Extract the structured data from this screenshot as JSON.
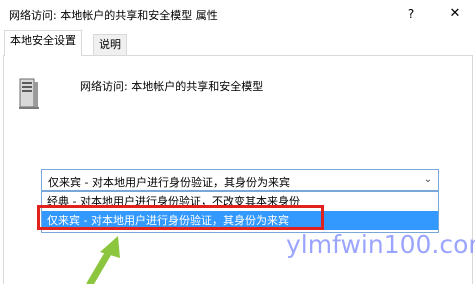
{
  "window": {
    "title": "网络访问: 本地帐户的共享和安全模型 属性",
    "help_label": "?",
    "close_label": "✕"
  },
  "tabs": [
    {
      "label": "本地安全设置",
      "active": true
    },
    {
      "label": "说明",
      "active": false
    }
  ],
  "policy": {
    "icon": "server-computer-icon",
    "name": "网络访问: 本地帐户的共享和安全模型"
  },
  "combo": {
    "selected": "仅来宾 - 对本地用户进行身份验证，其身份为来宾",
    "arrow": "⌄"
  },
  "dropdown": {
    "options": [
      {
        "label": "经典 - 对本地用户进行身份验证，不改变其本来身份",
        "highlighted": false
      },
      {
        "label": "仅来宾 - 对本地用户进行身份验证，其身份为来宾",
        "highlighted": true
      }
    ]
  },
  "annotation": {
    "highlight_color": "#e0211e",
    "arrow_color": "#8cc63f"
  },
  "watermark": {
    "text": "ylmfwin100.com"
  }
}
